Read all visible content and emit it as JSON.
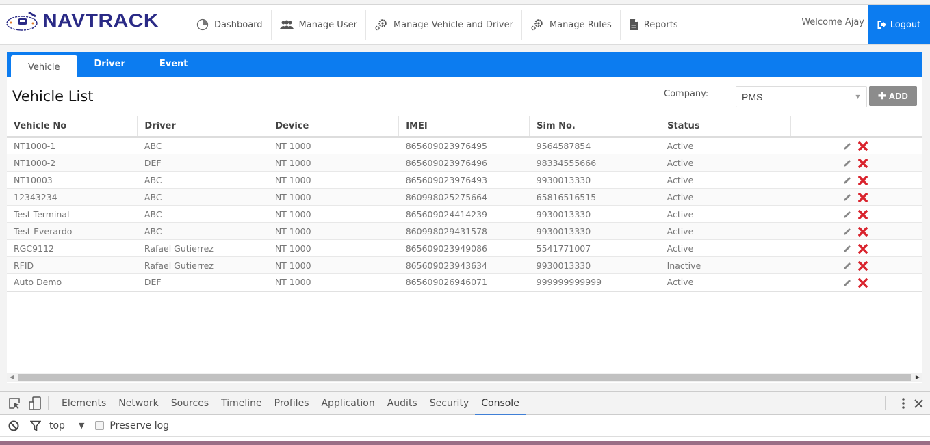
{
  "header": {
    "logo_text": "NAVTRACK",
    "nav": [
      {
        "label": "Dashboard",
        "icon": "pie-chart-icon"
      },
      {
        "label": "Manage User",
        "icon": "users-icon"
      },
      {
        "label": "Manage Vehicle and Driver",
        "icon": "gears-icon"
      },
      {
        "label": "Manage Rules",
        "icon": "gears-icon"
      },
      {
        "label": "Reports",
        "icon": "document-icon"
      }
    ],
    "welcome_prefix": "Welcome ",
    "user_name": "Ajay",
    "logout_label": "Logout"
  },
  "tabs": [
    {
      "label": "Vehicle",
      "active": true
    },
    {
      "label": "Driver",
      "active": false
    },
    {
      "label": "Event",
      "active": false
    }
  ],
  "page": {
    "title": "Vehicle List",
    "company_label": "Company:",
    "company_value": "PMS",
    "add_label": "ADD"
  },
  "table": {
    "columns": [
      "Vehicle No",
      "Driver",
      "Device",
      "IMEI",
      "Sim No.",
      "Status",
      ""
    ],
    "rows": [
      [
        "NT1000-1",
        "ABC",
        "NT 1000",
        "865609023976495",
        "9564587854",
        "Active"
      ],
      [
        "NT1000-2",
        "DEF",
        "NT 1000",
        "865609023976496",
        "98334555666",
        "Active"
      ],
      [
        "NT10003",
        "ABC",
        "NT 1000",
        "865609023976493",
        "9930013330",
        "Active"
      ],
      [
        "12343234",
        "ABC",
        "NT 1000",
        "860998025275664",
        "65816516515",
        "Active"
      ],
      [
        "Test Terminal",
        "ABC",
        "NT 1000",
        "865609024414239",
        "9930013330",
        "Active"
      ],
      [
        "Test-Everardo",
        "ABC",
        "NT 1000",
        "860998029431578",
        "9930013330",
        "Active"
      ],
      [
        "RGC9112",
        "Rafael Gutierrez",
        "NT 1000",
        "865609023949086",
        "5541771007",
        "Active"
      ],
      [
        "RFID",
        "Rafael Gutierrez",
        "NT 1000",
        "865609023943634",
        "9930013330",
        "Inactive"
      ],
      [
        "Auto Demo",
        "DEF",
        "NT 1000",
        "865609026946071",
        "999999999999",
        "Active"
      ]
    ]
  },
  "devtools": {
    "tabs": [
      "Elements",
      "Network",
      "Sources",
      "Timeline",
      "Profiles",
      "Application",
      "Audits",
      "Security",
      "Console"
    ],
    "active_tab": "Console",
    "context": "top",
    "preserve_log_label": "Preserve log",
    "preserve_log_checked": false
  },
  "colors": {
    "brand": "#0c7cf0",
    "logo": "#2a2a86",
    "delete": "#d9232d"
  }
}
